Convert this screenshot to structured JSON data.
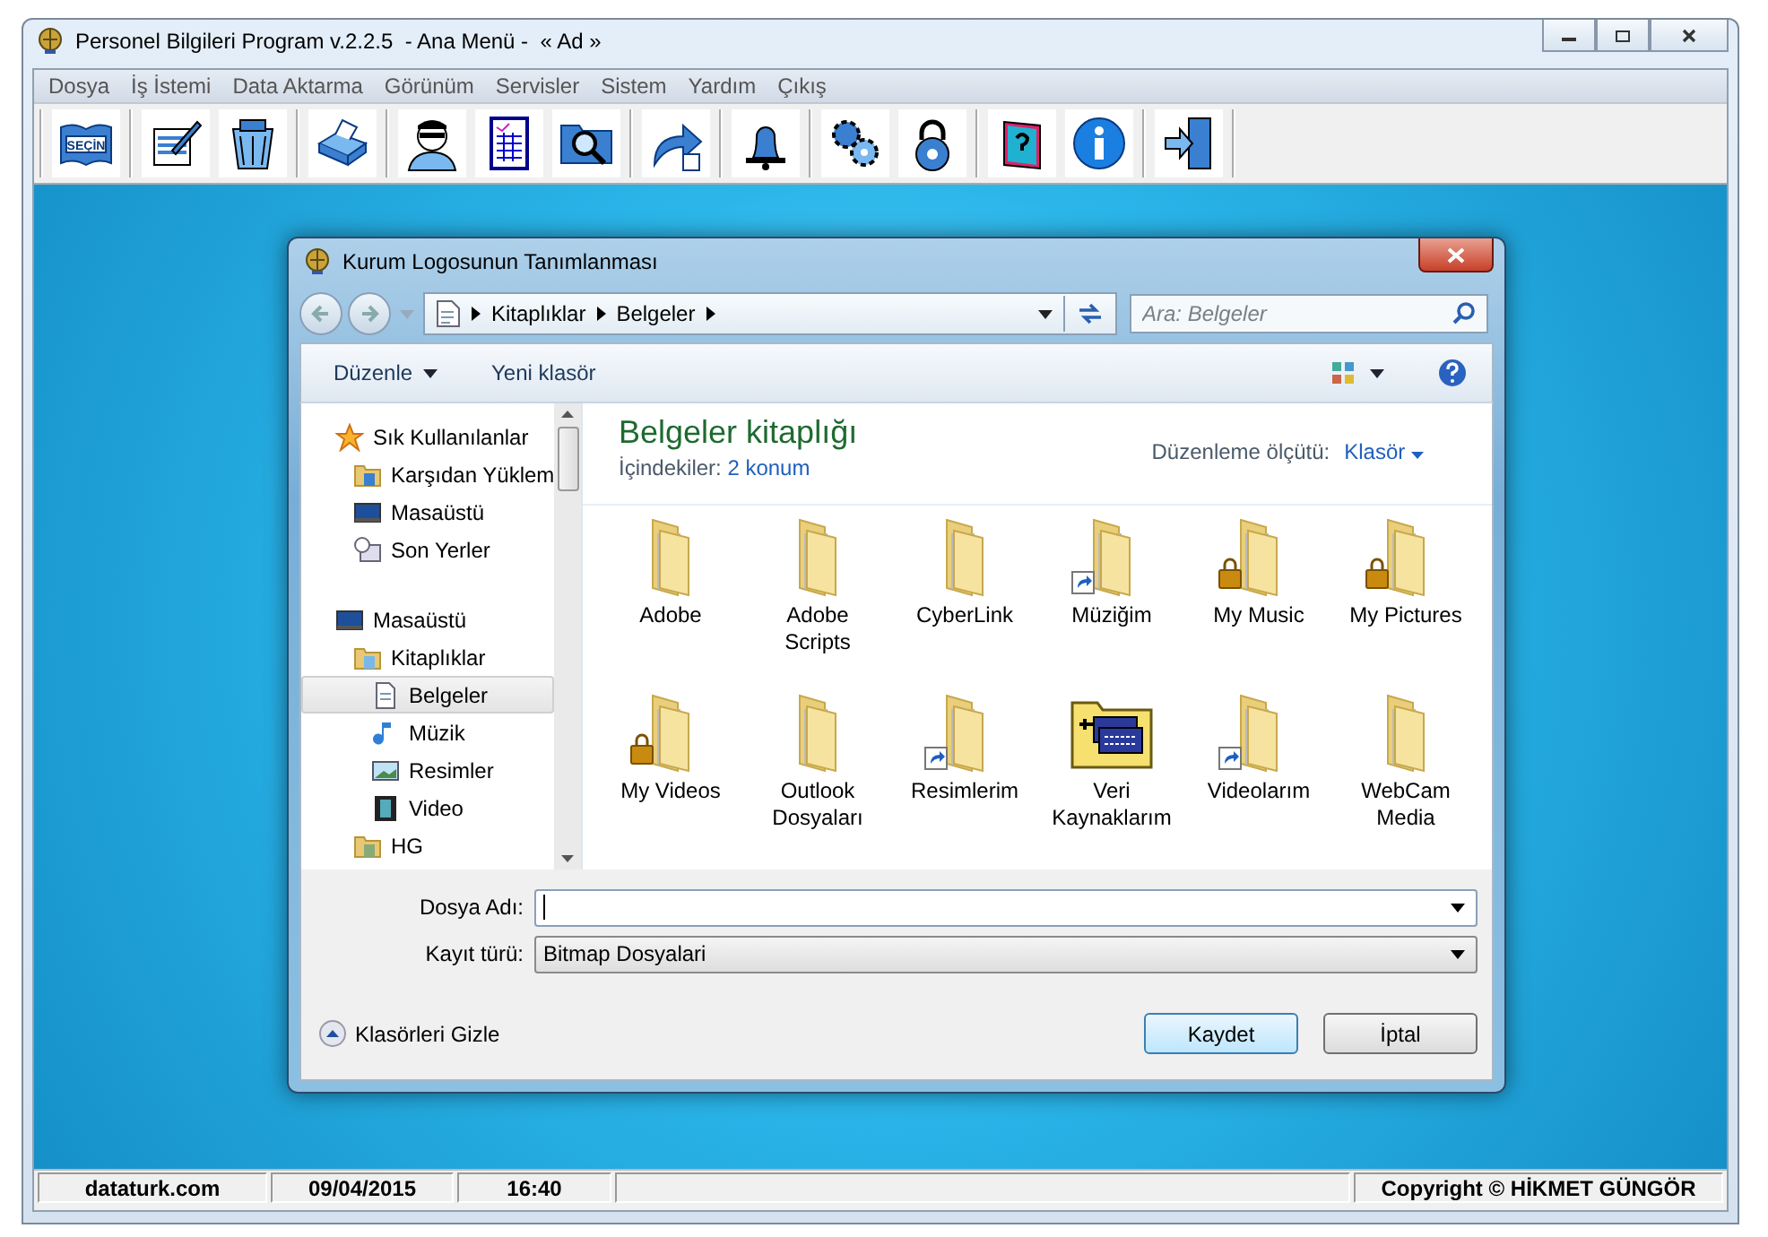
{
  "window": {
    "title": "Personel Bilgileri Program v.2.2.5  - Ana Menü -  « Ad »"
  },
  "menu": [
    "Dosya",
    "İş İstemi",
    "Data Aktarma",
    "Görünüm",
    "Servisler",
    "Sistem",
    "Yardım",
    "Çıkış"
  ],
  "toolbar": {
    "book_label": "SEÇİN"
  },
  "dialog": {
    "title": "Kurum Logosunun Tanımlanması",
    "breadcrumb": [
      "Kitaplıklar",
      "Belgeler"
    ],
    "search": {
      "placeholder": "Ara: Belgeler"
    },
    "commands": [
      "Düzenle",
      "Yeni klasör"
    ],
    "sidebar": {
      "items": [
        {
          "label": "Sık Kullanılanlar",
          "selected": false,
          "children": [
            {
              "label": "Karşıdan Yüklem",
              "selected": false
            },
            {
              "label": "Masaüstü",
              "selected": false
            },
            {
              "label": "Son Yerler",
              "selected": false
            }
          ]
        },
        {
          "label": "Masaüstü",
          "selected": false,
          "children": [
            {
              "label": "Kitaplıklar",
              "selected": false,
              "children": [
                {
                  "label": "Belgeler",
                  "selected": true
                },
                {
                  "label": "Müzik",
                  "selected": false
                },
                {
                  "label": "Resimler",
                  "selected": false
                },
                {
                  "label": "Video",
                  "selected": false
                }
              ]
            },
            {
              "label": "HG",
              "selected": false
            }
          ]
        }
      ]
    },
    "library": {
      "title": "Belgeler kitaplığı",
      "contents_label": "İçindekiler:",
      "contents_link": "2 konum",
      "arrange_label": "Düzenleme ölçütü:",
      "arrange_value": "Klasör"
    },
    "files": [
      {
        "name": "Adobe",
        "kind": "folder",
        "shortcut": false,
        "locked": false
      },
      {
        "name": "Adobe Scripts",
        "kind": "folder",
        "shortcut": false,
        "locked": false
      },
      {
        "name": "CyberLink",
        "kind": "folder",
        "shortcut": false,
        "locked": false
      },
      {
        "name": "Müziğim",
        "kind": "folder",
        "shortcut": true,
        "locked": false
      },
      {
        "name": "My Music",
        "kind": "folder",
        "shortcut": false,
        "locked": true
      },
      {
        "name": "My Pictures",
        "kind": "folder",
        "shortcut": false,
        "locked": true
      },
      {
        "name": "My Videos",
        "kind": "folder",
        "shortcut": false,
        "locked": true
      },
      {
        "name": "Outlook Dosyaları",
        "kind": "folder",
        "shortcut": false,
        "locked": false
      },
      {
        "name": "Resimlerim",
        "kind": "folder",
        "shortcut": true,
        "locked": false
      },
      {
        "name": "Veri Kaynaklarım",
        "kind": "datasource",
        "shortcut": false,
        "locked": false
      },
      {
        "name": "Videolarım",
        "kind": "folder",
        "shortcut": true,
        "locked": false
      },
      {
        "name": "WebCam Media",
        "kind": "folder",
        "shortcut": false,
        "locked": false
      }
    ],
    "filename": {
      "label": "Dosya Adı:"
    },
    "filetype": {
      "label": "Kayıt türü:",
      "value": "Bitmap Dosyalari"
    },
    "hide_folders": "Klasörleri Gizle",
    "buttons": [
      "Kaydet",
      "İptal"
    ]
  },
  "status_bar": {
    "left": [
      "dataturk.com",
      "09/04/2015",
      "16:40"
    ],
    "right": "Copyright © HİKMET GÜNGÖR"
  }
}
